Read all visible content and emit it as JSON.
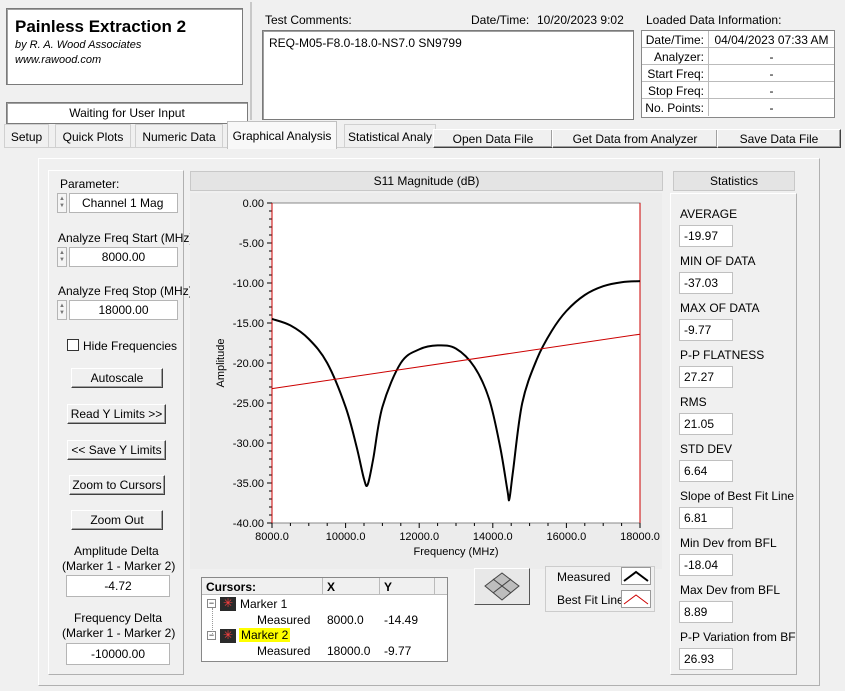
{
  "app": {
    "title": "Painless Extraction 2",
    "author": "by R. A. Wood Associates",
    "website": "www.rawood.com"
  },
  "status": "Waiting for User Input",
  "test_comments": {
    "label": "Test Comments:",
    "text": "REQ-M05-F8.0-18.0-NS7.0   SN9799",
    "datetime_label": "Date/Time:",
    "datetime_value": "10/20/2023  9:02"
  },
  "loaded_data": {
    "title": "Loaded Data Information:",
    "rows": [
      {
        "label": "Date/Time:",
        "value": "04/04/2023 07:33 AM"
      },
      {
        "label": "Analyzer:",
        "value": "-"
      },
      {
        "label": "Start Freq:",
        "value": "-"
      },
      {
        "label": "Stop Freq:",
        "value": "-"
      },
      {
        "label": "No. Points:",
        "value": "-"
      }
    ]
  },
  "tabs": [
    "Setup",
    "Quick Plots",
    "Numeric Data",
    "Graphical Analysis",
    "Statistical Analy"
  ],
  "active_tab": "Graphical Analysis",
  "top_buttons": {
    "open": "Open Data File",
    "get": "Get Data from Analyzer",
    "save": "Save Data File"
  },
  "left_panel": {
    "parameter_label": "Parameter:",
    "parameter_value": "Channel 1 Mag",
    "start_label": "Analyze Freq Start (MHz)",
    "start_value": "8000.00",
    "stop_label": "Analyze Freq Stop (MHz)",
    "stop_value": "18000.00",
    "hide_freq_label": "Hide Frequencies",
    "autoscale": "Autoscale",
    "read_y": "Read Y Limits >>",
    "save_y": "<< Save Y Limits",
    "zoom_cursors": "Zoom to Cursors",
    "zoom_out": "Zoom Out",
    "amp_delta_label1": "Amplitude Delta",
    "amp_delta_label2": "(Marker 1 - Marker 2)",
    "amp_delta_value": "-4.72",
    "freq_delta_label1": "Frequency Delta",
    "freq_delta_label2": "(Marker 1 - Marker 2)",
    "freq_delta_value": "-10000.00"
  },
  "cursors": {
    "headers": [
      "Cursors:",
      "X",
      "Y"
    ],
    "marker1": {
      "name": "Marker 1",
      "sub": "Measured",
      "x": "8000.0",
      "y": "-14.49"
    },
    "marker2": {
      "name": "Marker 2",
      "sub": "Measured",
      "x": "18000.0",
      "y": "-9.77"
    }
  },
  "legend": {
    "measured": "Measured",
    "best_fit": "Best Fit Line"
  },
  "statistics": {
    "title": "Statistics",
    "items": [
      {
        "label": "AVERAGE",
        "value": "-19.97"
      },
      {
        "label": "MIN OF DATA",
        "value": "-37.03"
      },
      {
        "label": "MAX OF DATA",
        "value": "-9.77"
      },
      {
        "label": "P-P FLATNESS",
        "value": "27.27"
      },
      {
        "label": "RMS",
        "value": "21.05"
      },
      {
        "label": "STD DEV",
        "value": "6.64"
      },
      {
        "label": "Slope of Best Fit Line",
        "value": "6.81"
      },
      {
        "label": "Min Dev from BFL",
        "value": "-18.04"
      },
      {
        "label": "Max Dev from BFL",
        "value": "8.89"
      },
      {
        "label": "P-P Variation from BF",
        "value": "26.93"
      }
    ]
  },
  "colors": {
    "measured": "#000000",
    "best_fit": "#cc0000",
    "cursor_line": "#cc0000",
    "marker2_highlight": "#ffff00"
  },
  "chart_data": {
    "type": "line",
    "title": "S11 Magnitude (dB)",
    "xlabel": "Frequency (MHz)",
    "ylabel": "Amplitude",
    "xlim": [
      8000,
      18000
    ],
    "ylim": [
      -40,
      0
    ],
    "x_ticks": [
      "8000.0",
      "10000.0",
      "12000.0",
      "14000.0",
      "16000.0",
      "18000.0"
    ],
    "y_ticks": [
      "0.00",
      "-5.00",
      "-10.00",
      "-15.00",
      "-20.00",
      "-25.00",
      "-30.00",
      "-35.00",
      "-40.00"
    ],
    "grid": false,
    "series": [
      {
        "name": "Measured",
        "x": [
          8000,
          8500,
          9000,
          9500,
          10000,
          10300,
          10500,
          10600,
          10750,
          11000,
          11500,
          12000,
          12500,
          13000,
          13500,
          13900,
          14200,
          14400,
          14450,
          14550,
          14800,
          15200,
          15600,
          16000,
          16500,
          17000,
          17500,
          18000
        ],
        "y": [
          -14.49,
          -15.3,
          -17.0,
          -20.0,
          -25.5,
          -30.5,
          -34.5,
          -35.2,
          -32.0,
          -25.5,
          -20.0,
          -18.3,
          -17.8,
          -18.2,
          -20.5,
          -24.5,
          -30.5,
          -36.0,
          -37.0,
          -33.5,
          -25.0,
          -19.5,
          -16.0,
          -13.5,
          -11.5,
          -10.4,
          -9.9,
          -9.77
        ]
      },
      {
        "name": "Best Fit Line",
        "x": [
          8000,
          18000
        ],
        "y": [
          -23.2,
          -16.4
        ]
      }
    ],
    "cursors": [
      {
        "name": "Marker 1",
        "x": 8000
      },
      {
        "name": "Marker 2",
        "x": 18000
      }
    ]
  }
}
